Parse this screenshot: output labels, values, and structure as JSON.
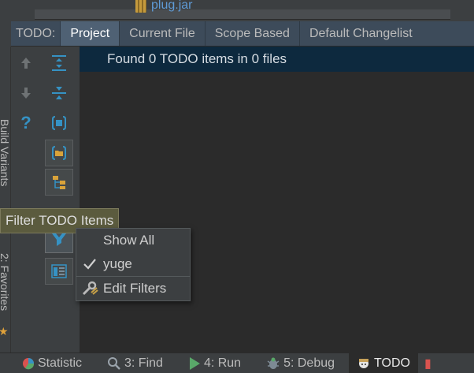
{
  "file_strip": {
    "file_name": "plug.jar"
  },
  "tabs": {
    "prefix": "TODO:",
    "items": [
      {
        "label": "Project",
        "active": true
      },
      {
        "label": "Current File",
        "active": false
      },
      {
        "label": "Scope Based",
        "active": false
      },
      {
        "label": "Default Changelist",
        "active": false
      }
    ]
  },
  "left_strip": {
    "build_variants": "Build Variants",
    "favorites": "2: Favorites"
  },
  "main": {
    "status": "Found 0 TODO items in 0 files"
  },
  "tooltip": {
    "text": "Filter TODO Items"
  },
  "menu": {
    "items": [
      {
        "label": "Show All",
        "checked": false
      },
      {
        "label": "yuge",
        "checked": true
      },
      {
        "label": "Edit Filters"
      }
    ]
  },
  "bottom_bar": {
    "items": [
      {
        "label": "Statistic",
        "icon": "statistic-icon"
      },
      {
        "label": "3: Find",
        "icon": "find-icon"
      },
      {
        "label": "4: Run",
        "icon": "run-icon"
      },
      {
        "label": "5: Debug",
        "icon": "debug-icon"
      },
      {
        "label": "TODO",
        "icon": "todo-icon",
        "active": true
      }
    ]
  },
  "colors": {
    "accent_blue": "#3592c4",
    "selection_header": "#0d293e",
    "tooltip_bg": "#5b5b3e",
    "run_green": "#59a869"
  }
}
